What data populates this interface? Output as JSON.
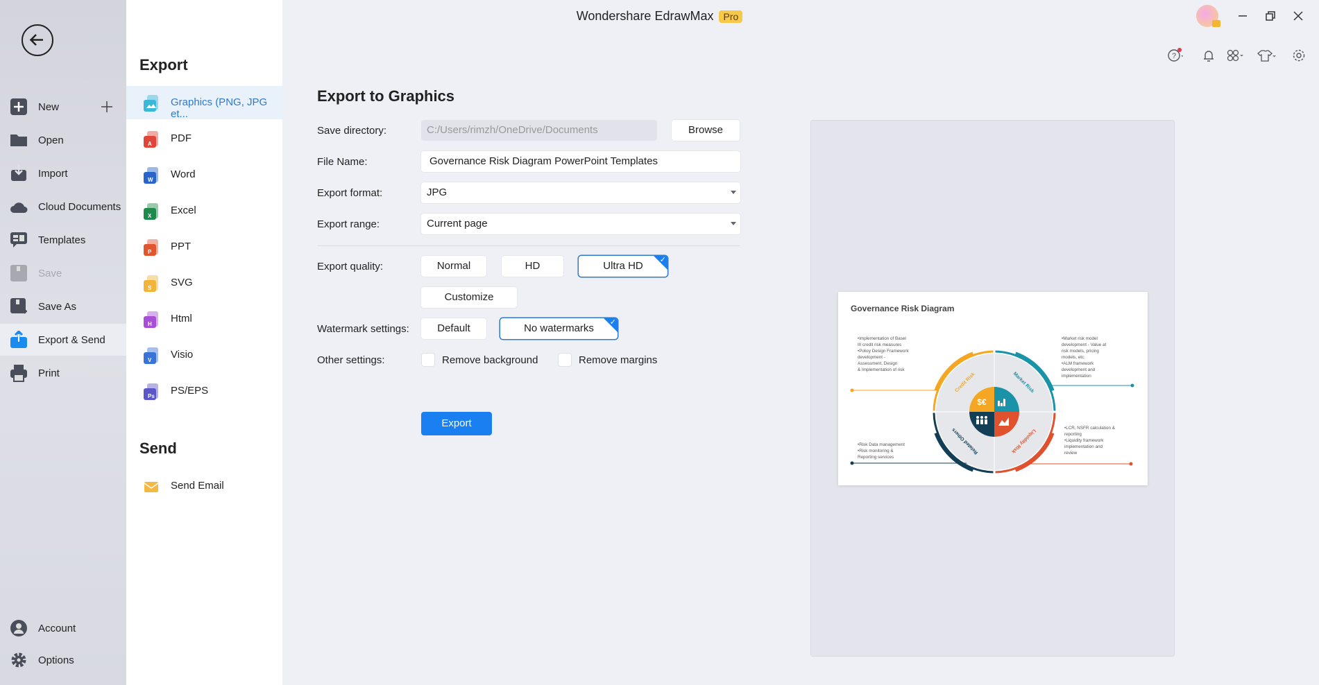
{
  "app": {
    "title": "Wondershare EdrawMax",
    "badge": "Pro"
  },
  "window_controls": [
    "minimize-icon",
    "restore-icon",
    "close-icon"
  ],
  "toolbar_icons": [
    "help-icon",
    "bell-icon",
    "apps-icon",
    "shirt-icon",
    "gear-icon"
  ],
  "nav": {
    "items": [
      {
        "label": "New",
        "icon": "plus-square-icon"
      },
      {
        "label": "Open",
        "icon": "folder-icon"
      },
      {
        "label": "Import",
        "icon": "import-icon"
      },
      {
        "label": "Cloud Documents",
        "icon": "cloud-icon"
      },
      {
        "label": "Templates",
        "icon": "templates-icon"
      },
      {
        "label": "Save",
        "icon": "save-icon",
        "disabled": true
      },
      {
        "label": "Save As",
        "icon": "save-as-icon"
      },
      {
        "label": "Export & Send",
        "icon": "export-icon",
        "active": true
      },
      {
        "label": "Print",
        "icon": "print-icon"
      }
    ],
    "bottom": [
      {
        "label": "Account",
        "icon": "account-icon"
      },
      {
        "label": "Options",
        "icon": "options-icon"
      }
    ]
  },
  "export_menu": {
    "heading": "Export",
    "items": [
      {
        "label": "Graphics (PNG, JPG et...",
        "color": "#3bb8d8",
        "letter": ""
      },
      {
        "label": "PDF",
        "color": "#e0453a",
        "letter": "A"
      },
      {
        "label": "Word",
        "color": "#2b64c8",
        "letter": "W"
      },
      {
        "label": "Excel",
        "color": "#1f8a4c",
        "letter": "X"
      },
      {
        "label": "PPT",
        "color": "#e0572f",
        "letter": "P"
      },
      {
        "label": "SVG",
        "color": "#f0b53a",
        "letter": "S"
      },
      {
        "label": "Html",
        "color": "#a94fd6",
        "letter": "H"
      },
      {
        "label": "Visio",
        "color": "#3a73d6",
        "letter": "V"
      },
      {
        "label": "PS/EPS",
        "color": "#5a55c8",
        "letter": "Ps"
      }
    ],
    "send_heading": "Send",
    "send_items": [
      {
        "label": "Send Email",
        "color": "#f5b942"
      }
    ]
  },
  "form": {
    "title": "Export to Graphics",
    "save_directory": {
      "label": "Save directory:",
      "value": "C:/Users/rimzh/OneDrive/Documents",
      "browse": "Browse"
    },
    "file_name": {
      "label": "File Name:",
      "value": "Governance Risk Diagram PowerPoint Templates"
    },
    "export_format": {
      "label": "Export format:",
      "value": "JPG"
    },
    "export_range": {
      "label": "Export range:",
      "value": "Current page"
    },
    "export_quality": {
      "label": "Export quality:",
      "options": [
        "Normal",
        "HD",
        "Ultra HD"
      ],
      "selected": "Ultra HD",
      "customize": "Customize"
    },
    "watermark": {
      "label": "Watermark settings:",
      "options": [
        "Default",
        "No watermarks"
      ],
      "selected": "No watermarks"
    },
    "other": {
      "label": "Other settings:",
      "remove_background": {
        "label": "Remove background",
        "checked": false
      },
      "remove_margins": {
        "label": "Remove margins",
        "checked": false
      }
    },
    "export_button": "Export"
  },
  "preview": {
    "title": "Governance Risk Diagram",
    "quadrants": [
      {
        "label": "Credit Risk",
        "color": "#f5a623"
      },
      {
        "label": "Market Risk",
        "color": "#1a93a8"
      },
      {
        "label": "Liquidity Risk",
        "color": "#e0522d"
      },
      {
        "label": "Related Others",
        "color": "#123f55"
      }
    ],
    "center_symbol": "$€",
    "notes": {
      "top_left": [
        "•Implementation of Basel",
        "  III credit risk measures",
        "•Policy Design Framework",
        "  development -",
        "  Assessment, Design",
        "  & Implementation of risk"
      ],
      "top_right": [
        "•Market risk model",
        "  development - Value at",
        "  risk models, pricing",
        "  models, etc.",
        "•ALM framework",
        "  development and",
        "  implementation"
      ],
      "bottom_left": [
        "•Risk Data management",
        "•Risk monitoring &",
        "  Reporting services"
      ],
      "bottom_right": [
        "•LCR, NSFR calculation &",
        "  reporting",
        "•Liquidity framework",
        "  implementation and",
        "  review"
      ]
    }
  }
}
